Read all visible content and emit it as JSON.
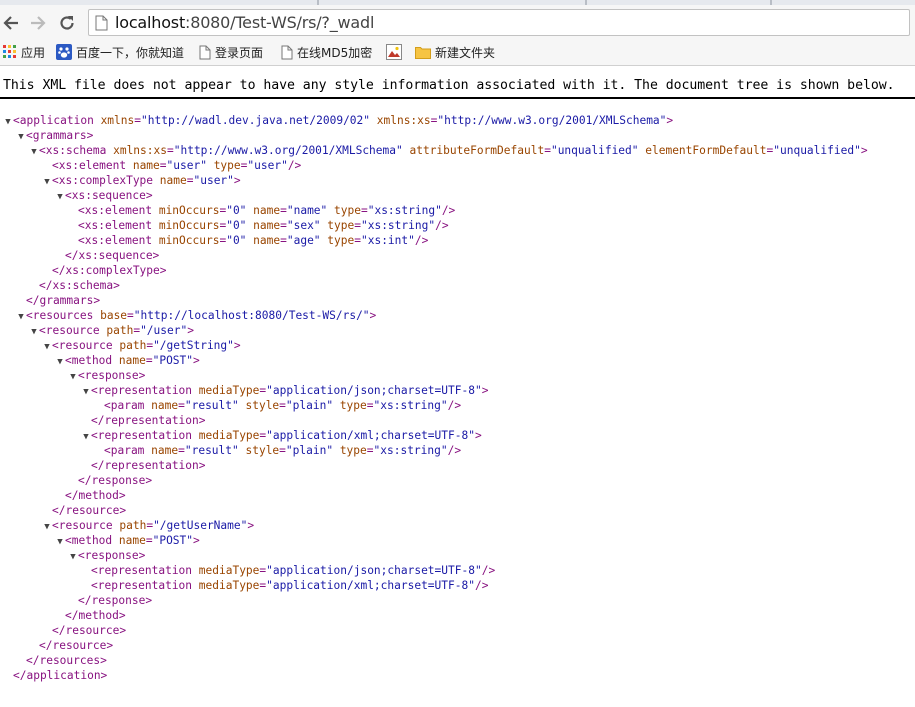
{
  "browser": {
    "url_host": "localhost",
    "url_path": ":8080/Test-WS/rs/?_wadl",
    "bookmarks": [
      "应用",
      "百度一下，你就知道",
      "登录页面",
      "在线MD5加密",
      "",
      "新建文件夹"
    ]
  },
  "notice": "This XML file does not appear to have any style information associated with it. The document tree is shown below.",
  "xml_lines": [
    {
      "depth": 0,
      "toggle": "▼",
      "html": "<span class='tag'>&lt;application </span><span class='an'>xmlns</span><span class='tag'>=</span><span class='av'>\"http://wadl.dev.java.net/2009/02\"</span><span class='an'> xmlns:xs</span><span class='tag'>=</span><span class='av'>\"http://www.w3.org/2001/XMLSchema\"</span><span class='tag'>&gt;</span>"
    },
    {
      "depth": 1,
      "toggle": "▼",
      "html": "<span class='tag'>&lt;grammars&gt;</span>"
    },
    {
      "depth": 2,
      "toggle": "▼",
      "html": "<span class='tag'>&lt;xs:schema </span><span class='an'>xmlns:xs</span><span class='tag'>=</span><span class='av'>\"http://www.w3.org/2001/XMLSchema\"</span><span class='an'> attributeFormDefault</span><span class='tag'>=</span><span class='av'>\"unqualified\"</span><span class='an'> elementFormDefault</span><span class='tag'>=</span><span class='av'>\"unqualified\"</span><span class='tag'>&gt;</span>"
    },
    {
      "depth": 3,
      "toggle": "",
      "html": "<span class='tag'>&lt;xs:element </span><span class='an'>name</span><span class='tag'>=</span><span class='av'>\"user\"</span><span class='an'> type</span><span class='tag'>=</span><span class='av'>\"user\"</span><span class='tag'>/&gt;</span>"
    },
    {
      "depth": 3,
      "toggle": "▼",
      "html": "<span class='tag'>&lt;xs:complexType </span><span class='an'>name</span><span class='tag'>=</span><span class='av'>\"user\"</span><span class='tag'>&gt;</span>"
    },
    {
      "depth": 4,
      "toggle": "▼",
      "html": "<span class='tag'>&lt;xs:sequence&gt;</span>"
    },
    {
      "depth": 5,
      "toggle": "",
      "html": "<span class='tag'>&lt;xs:element </span><span class='an'>minOccurs</span><span class='tag'>=</span><span class='av'>\"0\"</span><span class='an'> name</span><span class='tag'>=</span><span class='av'>\"name\"</span><span class='an'> type</span><span class='tag'>=</span><span class='av'>\"xs:string\"</span><span class='tag'>/&gt;</span>"
    },
    {
      "depth": 5,
      "toggle": "",
      "html": "<span class='tag'>&lt;xs:element </span><span class='an'>minOccurs</span><span class='tag'>=</span><span class='av'>\"0\"</span><span class='an'> name</span><span class='tag'>=</span><span class='av'>\"sex\"</span><span class='an'> type</span><span class='tag'>=</span><span class='av'>\"xs:string\"</span><span class='tag'>/&gt;</span>"
    },
    {
      "depth": 5,
      "toggle": "",
      "html": "<span class='tag'>&lt;xs:element </span><span class='an'>minOccurs</span><span class='tag'>=</span><span class='av'>\"0\"</span><span class='an'> name</span><span class='tag'>=</span><span class='av'>\"age\"</span><span class='an'> type</span><span class='tag'>=</span><span class='av'>\"xs:int\"</span><span class='tag'>/&gt;</span>"
    },
    {
      "depth": 4,
      "toggle": "",
      "html": "<span class='tag'>&lt;/xs:sequence&gt;</span>"
    },
    {
      "depth": 3,
      "toggle": "",
      "html": "<span class='tag'>&lt;/xs:complexType&gt;</span>"
    },
    {
      "depth": 2,
      "toggle": "",
      "html": "<span class='tag'>&lt;/xs:schema&gt;</span>"
    },
    {
      "depth": 1,
      "toggle": "",
      "html": "<span class='tag'>&lt;/grammars&gt;</span>"
    },
    {
      "depth": 1,
      "toggle": "▼",
      "html": "<span class='tag'>&lt;resources </span><span class='an'>base</span><span class='tag'>=</span><span class='av'>\"http://localhost:8080/Test-WS/rs/\"</span><span class='tag'>&gt;</span>"
    },
    {
      "depth": 2,
      "toggle": "▼",
      "html": "<span class='tag'>&lt;resource </span><span class='an'>path</span><span class='tag'>=</span><span class='av'>\"/user\"</span><span class='tag'>&gt;</span>"
    },
    {
      "depth": 3,
      "toggle": "▼",
      "html": "<span class='tag'>&lt;resource </span><span class='an'>path</span><span class='tag'>=</span><span class='av'>\"/getString\"</span><span class='tag'>&gt;</span>"
    },
    {
      "depth": 4,
      "toggle": "▼",
      "html": "<span class='tag'>&lt;method </span><span class='an'>name</span><span class='tag'>=</span><span class='av'>\"POST\"</span><span class='tag'>&gt;</span>"
    },
    {
      "depth": 5,
      "toggle": "▼",
      "html": "<span class='tag'>&lt;response&gt;</span>"
    },
    {
      "depth": 6,
      "toggle": "▼",
      "html": "<span class='tag'>&lt;representation </span><span class='an'>mediaType</span><span class='tag'>=</span><span class='av'>\"application/json;charset=UTF-8\"</span><span class='tag'>&gt;</span>"
    },
    {
      "depth": 7,
      "toggle": "",
      "html": "<span class='tag'>&lt;param </span><span class='an'>name</span><span class='tag'>=</span><span class='av'>\"result\"</span><span class='an'> style</span><span class='tag'>=</span><span class='av'>\"plain\"</span><span class='an'> type</span><span class='tag'>=</span><span class='av'>\"xs:string\"</span><span class='tag'>/&gt;</span>"
    },
    {
      "depth": 6,
      "toggle": "",
      "html": "<span class='tag'>&lt;/representation&gt;</span>"
    },
    {
      "depth": 6,
      "toggle": "▼",
      "html": "<span class='tag'>&lt;representation </span><span class='an'>mediaType</span><span class='tag'>=</span><span class='av'>\"application/xml;charset=UTF-8\"</span><span class='tag'>&gt;</span>"
    },
    {
      "depth": 7,
      "toggle": "",
      "html": "<span class='tag'>&lt;param </span><span class='an'>name</span><span class='tag'>=</span><span class='av'>\"result\"</span><span class='an'> style</span><span class='tag'>=</span><span class='av'>\"plain\"</span><span class='an'> type</span><span class='tag'>=</span><span class='av'>\"xs:string\"</span><span class='tag'>/&gt;</span>"
    },
    {
      "depth": 6,
      "toggle": "",
      "html": "<span class='tag'>&lt;/representation&gt;</span>"
    },
    {
      "depth": 5,
      "toggle": "",
      "html": "<span class='tag'>&lt;/response&gt;</span>"
    },
    {
      "depth": 4,
      "toggle": "",
      "html": "<span class='tag'>&lt;/method&gt;</span>"
    },
    {
      "depth": 3,
      "toggle": "",
      "html": "<span class='tag'>&lt;/resource&gt;</span>"
    },
    {
      "depth": 3,
      "toggle": "▼",
      "html": "<span class='tag'>&lt;resource </span><span class='an'>path</span><span class='tag'>=</span><span class='av'>\"/getUserName\"</span><span class='tag'>&gt;</span>"
    },
    {
      "depth": 4,
      "toggle": "▼",
      "html": "<span class='tag'>&lt;method </span><span class='an'>name</span><span class='tag'>=</span><span class='av'>\"POST\"</span><span class='tag'>&gt;</span>"
    },
    {
      "depth": 5,
      "toggle": "▼",
      "html": "<span class='tag'>&lt;response&gt;</span>"
    },
    {
      "depth": 6,
      "toggle": "",
      "html": "<span class='tag'>&lt;representation </span><span class='an'>mediaType</span><span class='tag'>=</span><span class='av'>\"application/json;charset=UTF-8\"</span><span class='tag'>/&gt;</span>"
    },
    {
      "depth": 6,
      "toggle": "",
      "html": "<span class='tag'>&lt;representation </span><span class='an'>mediaType</span><span class='tag'>=</span><span class='av'>\"application/xml;charset=UTF-8\"</span><span class='tag'>/&gt;</span>"
    },
    {
      "depth": 5,
      "toggle": "",
      "html": "<span class='tag'>&lt;/response&gt;</span>"
    },
    {
      "depth": 4,
      "toggle": "",
      "html": "<span class='tag'>&lt;/method&gt;</span>"
    },
    {
      "depth": 3,
      "toggle": "",
      "html": "<span class='tag'>&lt;/resource&gt;</span>"
    },
    {
      "depth": 2,
      "toggle": "",
      "html": "<span class='tag'>&lt;/resource&gt;</span>"
    },
    {
      "depth": 1,
      "toggle": "",
      "html": "<span class='tag'>&lt;/resources&gt;</span>"
    },
    {
      "depth": 0,
      "toggle": "",
      "html": "<span class='tag'>&lt;/application&gt;</span>"
    }
  ],
  "colors": {
    "tag": "#881280",
    "attr_name": "#994500",
    "attr_value": "#1a1aa6"
  },
  "icons": {
    "back": "arrow-left-icon",
    "forward": "arrow-right-icon",
    "reload": "reload-icon",
    "page": "page-icon",
    "apps": "apps-grid-icon",
    "baidu": "baidu-paw-icon",
    "doc": "document-icon",
    "image": "image-bookmark-icon",
    "folder": "folder-icon"
  }
}
